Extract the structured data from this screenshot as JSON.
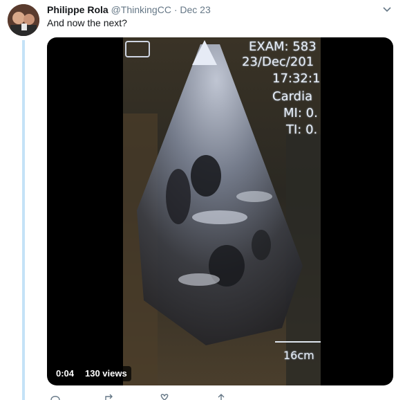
{
  "tweet": {
    "author_name": "Philippe Rola",
    "author_handle": "@ThinkingCC",
    "separator": "·",
    "date": "Dec 23",
    "text": "And now the next?"
  },
  "video": {
    "overlay": {
      "exam": "EXAM: 583",
      "date": "23/Dec/201",
      "time": "17:32:1",
      "preset": "Cardia",
      "mi": "MI: 0.",
      "ti": "TI: 0.",
      "depth": "16cm"
    },
    "duration": "0:04",
    "views": "130 views"
  },
  "actions": {
    "reply_count": "",
    "retweet_count": "",
    "like_count": "",
    "share_count": ""
  },
  "colors": {
    "name": "#14171a",
    "meta": "#657786",
    "thread_line": "#c4e2f7",
    "media_bg": "#000000"
  }
}
